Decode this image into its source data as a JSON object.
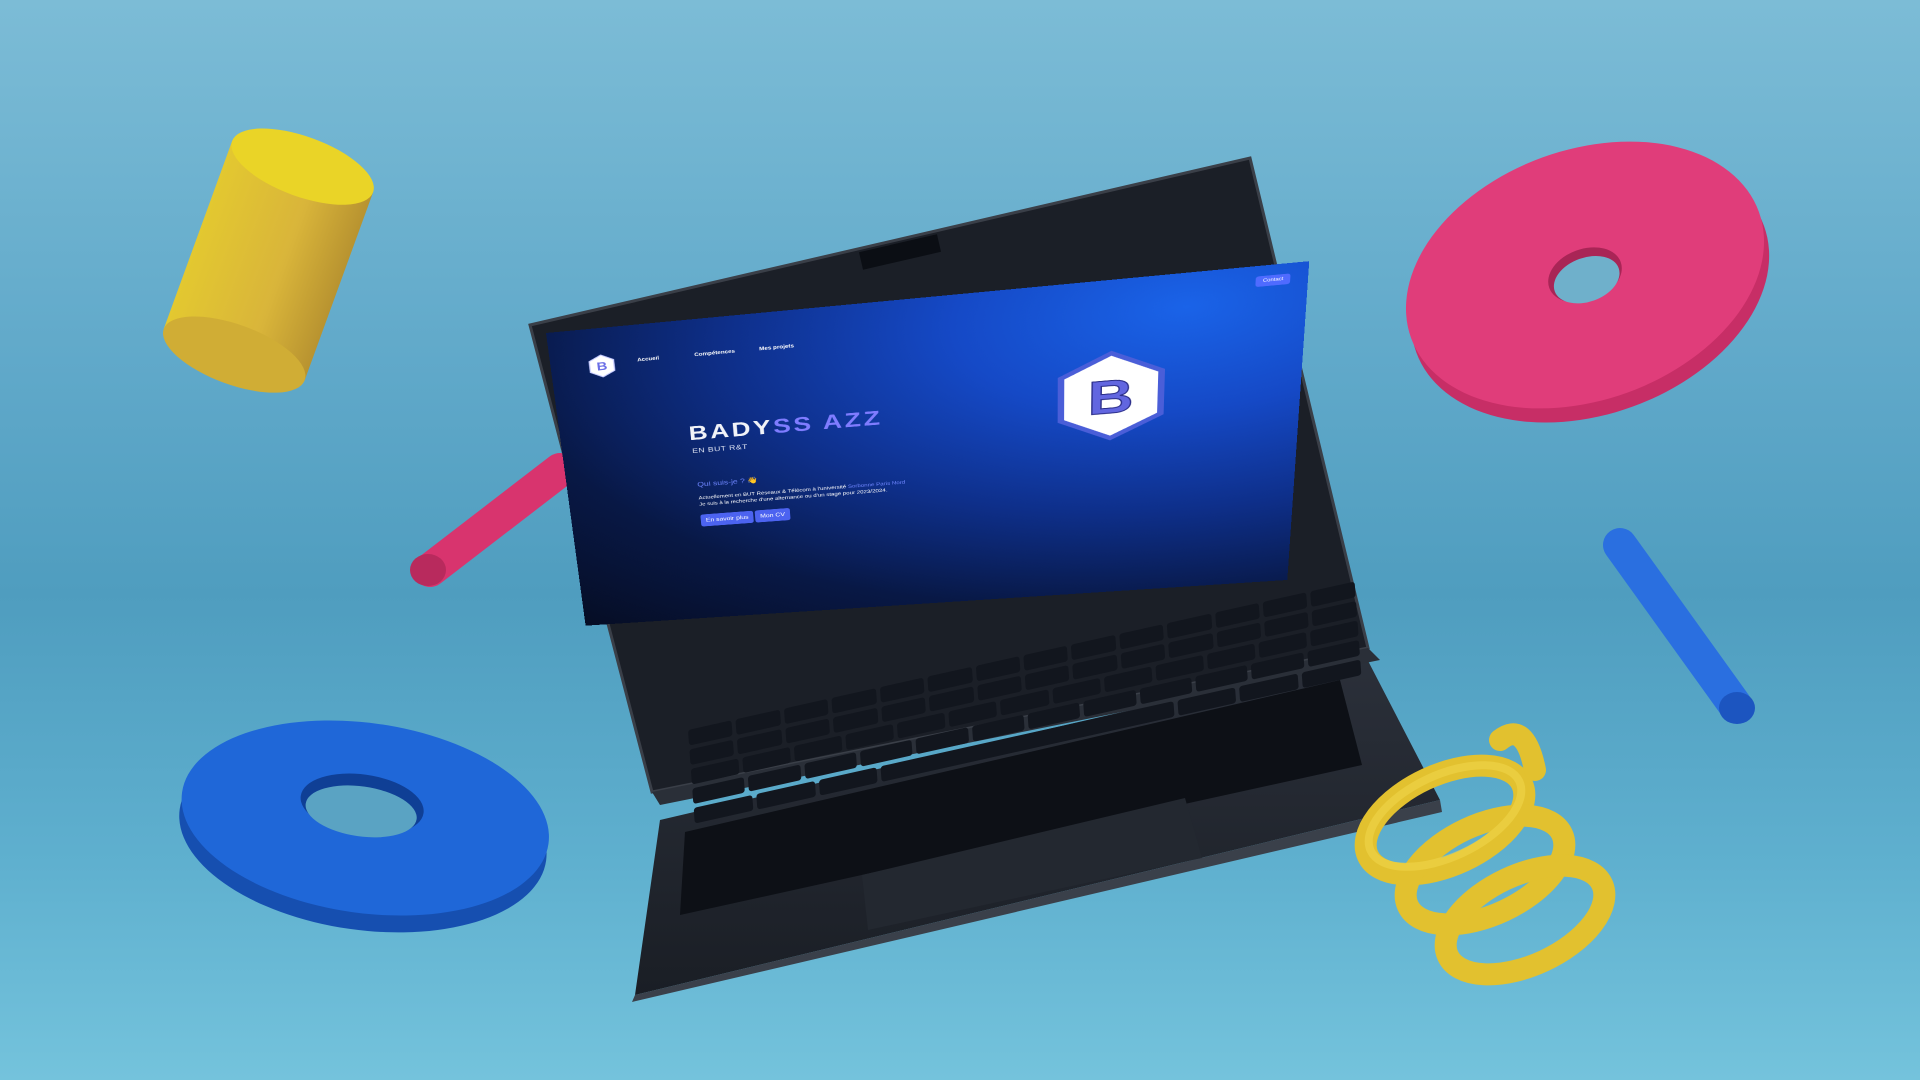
{
  "site": {
    "nav": {
      "links": [
        "Accueil",
        "Compétences",
        "Mes projets"
      ],
      "contact_label": "Contact"
    },
    "logo_letter": "B",
    "hero": {
      "name_part1": "BADY",
      "name_part2": "SS AZZ",
      "subtitle": "EN BUT R&T"
    },
    "about": {
      "title": "Qui suis-je ? 👋",
      "line1_start": "Actuellement en BUT Réseaux & Télécom à l'université ",
      "line1_highlight": "Sorbonne Paris Nord",
      "line2": "Je suis à la recherche d'une alternance ou d'un stage pour 2023/2024.",
      "btn_more": "En savoir plus",
      "btn_cv": "Mon CV"
    }
  },
  "colors": {
    "accent": "#4f6bff",
    "background_top": "#7cbcd6",
    "yellow_shape": "#e8c927",
    "pink_shape": "#e03d7a",
    "blue_shape": "#1f67d8"
  },
  "decor": [
    "yellow-cylinder",
    "pink-disc",
    "blue-disc",
    "pink-rod",
    "blue-rod",
    "yellow-spring"
  ]
}
